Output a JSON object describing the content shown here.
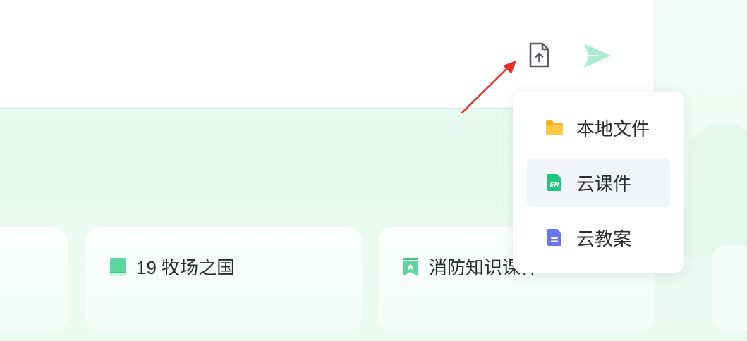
{
  "cards": [
    {
      "title": ""
    },
    {
      "title": "19 牧场之国"
    },
    {
      "title": "消防知识课件"
    }
  ],
  "upload_menu": {
    "items": [
      {
        "label": "本地文件",
        "icon": "folder-icon"
      },
      {
        "label": "云课件",
        "icon": "en-courseware-icon"
      },
      {
        "label": "云教案",
        "icon": "document-icon"
      }
    ],
    "active_index": 1
  },
  "colors": {
    "send": "#a9ecd0",
    "upload_icon": "#5a5a66",
    "arrow": "#e8302a",
    "folder": "#ffb01f",
    "courseware": "#1fc77e",
    "lesson_plan": "#6a73f2",
    "book": "#5dd6a0"
  }
}
